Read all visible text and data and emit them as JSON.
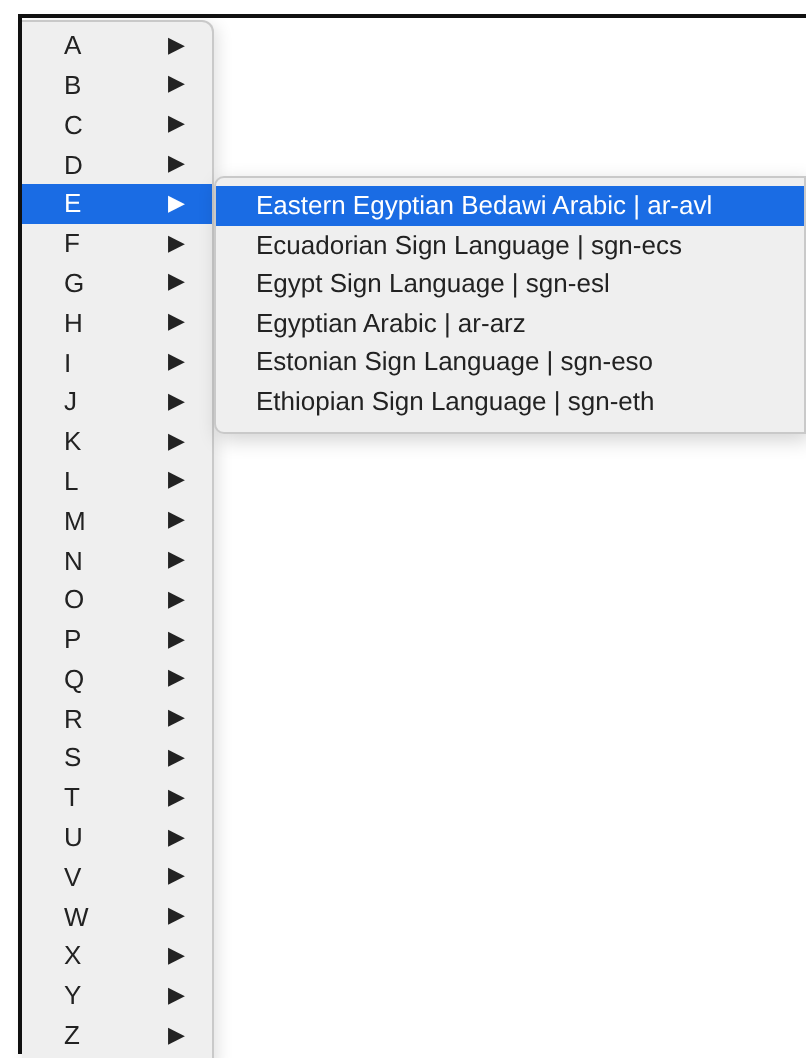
{
  "menu": {
    "items": [
      {
        "label": "A",
        "arrow": "▶",
        "selected": false
      },
      {
        "label": "B",
        "arrow": "▶",
        "selected": false
      },
      {
        "label": "C",
        "arrow": "▶",
        "selected": false
      },
      {
        "label": "D",
        "arrow": "▶",
        "selected": false
      },
      {
        "label": "E",
        "arrow": "▶",
        "selected": true,
        "submenu": [
          {
            "label": "Eastern Egyptian Bedawi Arabic | ar-avl",
            "selected": true
          },
          {
            "label": "Ecuadorian Sign Language | sgn-ecs",
            "selected": false
          },
          {
            "label": "Egypt Sign Language | sgn-esl",
            "selected": false
          },
          {
            "label": "Egyptian Arabic | ar-arz",
            "selected": false
          },
          {
            "label": "Estonian Sign Language | sgn-eso",
            "selected": false
          },
          {
            "label": "Ethiopian Sign Language | sgn-eth",
            "selected": false
          }
        ]
      },
      {
        "label": "F",
        "arrow": "▶",
        "selected": false
      },
      {
        "label": "G",
        "arrow": "▶",
        "selected": false
      },
      {
        "label": "H",
        "arrow": "▶",
        "selected": false
      },
      {
        "label": "I",
        "arrow": "▶",
        "selected": false
      },
      {
        "label": "J",
        "arrow": "▶",
        "selected": false
      },
      {
        "label": "K",
        "arrow": "▶",
        "selected": false
      },
      {
        "label": "L",
        "arrow": "▶",
        "selected": false
      },
      {
        "label": "M",
        "arrow": "▶",
        "selected": false
      },
      {
        "label": "N",
        "arrow": "▶",
        "selected": false
      },
      {
        "label": "O",
        "arrow": "▶",
        "selected": false
      },
      {
        "label": "P",
        "arrow": "▶",
        "selected": false
      },
      {
        "label": "Q",
        "arrow": "▶",
        "selected": false
      },
      {
        "label": "R",
        "arrow": "▶",
        "selected": false
      },
      {
        "label": "S",
        "arrow": "▶",
        "selected": false
      },
      {
        "label": "T",
        "arrow": "▶",
        "selected": false
      },
      {
        "label": "U",
        "arrow": "▶",
        "selected": false
      },
      {
        "label": "V",
        "arrow": "▶",
        "selected": false
      },
      {
        "label": "W",
        "arrow": "▶",
        "selected": false
      },
      {
        "label": "X",
        "arrow": "▶",
        "selected": false
      },
      {
        "label": "Y",
        "arrow": "▶",
        "selected": false
      },
      {
        "label": "Z",
        "arrow": "▶",
        "selected": false
      }
    ]
  }
}
